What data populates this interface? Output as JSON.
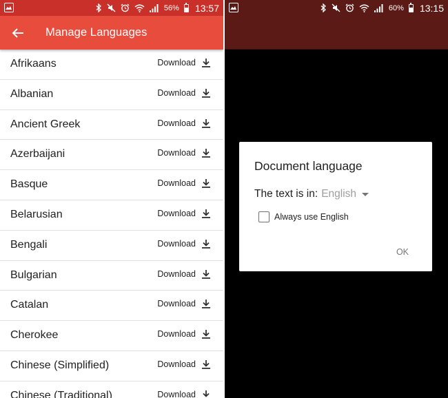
{
  "left_screen": {
    "status_bar": {
      "battery_percent": "56%",
      "battery_level": 0.56,
      "time": "13:57"
    },
    "app_bar": {
      "title": "Manage Languages",
      "back_icon": "arrow-back-icon"
    },
    "languages": [
      {
        "name": "Afrikaans",
        "action": "Download"
      },
      {
        "name": "Albanian",
        "action": "Download"
      },
      {
        "name": "Ancient Greek",
        "action": "Download"
      },
      {
        "name": "Azerbaijani",
        "action": "Download"
      },
      {
        "name": "Basque",
        "action": "Download"
      },
      {
        "name": "Belarusian",
        "action": "Download"
      },
      {
        "name": "Bengali",
        "action": "Download"
      },
      {
        "name": "Bulgarian",
        "action": "Download"
      },
      {
        "name": "Catalan",
        "action": "Download"
      },
      {
        "name": "Cherokee",
        "action": "Download"
      },
      {
        "name": "Chinese (Simplified)",
        "action": "Download"
      },
      {
        "name": "Chinese (Traditional)",
        "action": "Download"
      }
    ]
  },
  "right_screen": {
    "status_bar": {
      "battery_percent": "60%",
      "battery_level": 0.6,
      "time": "13:15"
    },
    "dialog": {
      "title": "Document language",
      "text_is_in_label": "The text is in:",
      "selected_language": "English",
      "checkbox_label": "Always use English",
      "checkbox_checked": false,
      "ok_label": "OK"
    }
  },
  "colors": {
    "left_status_bar": "#c9302a",
    "left_app_bar": "#e84c3d",
    "right_status_bar": "#5b1a16",
    "dimmed_background": "#000000"
  }
}
